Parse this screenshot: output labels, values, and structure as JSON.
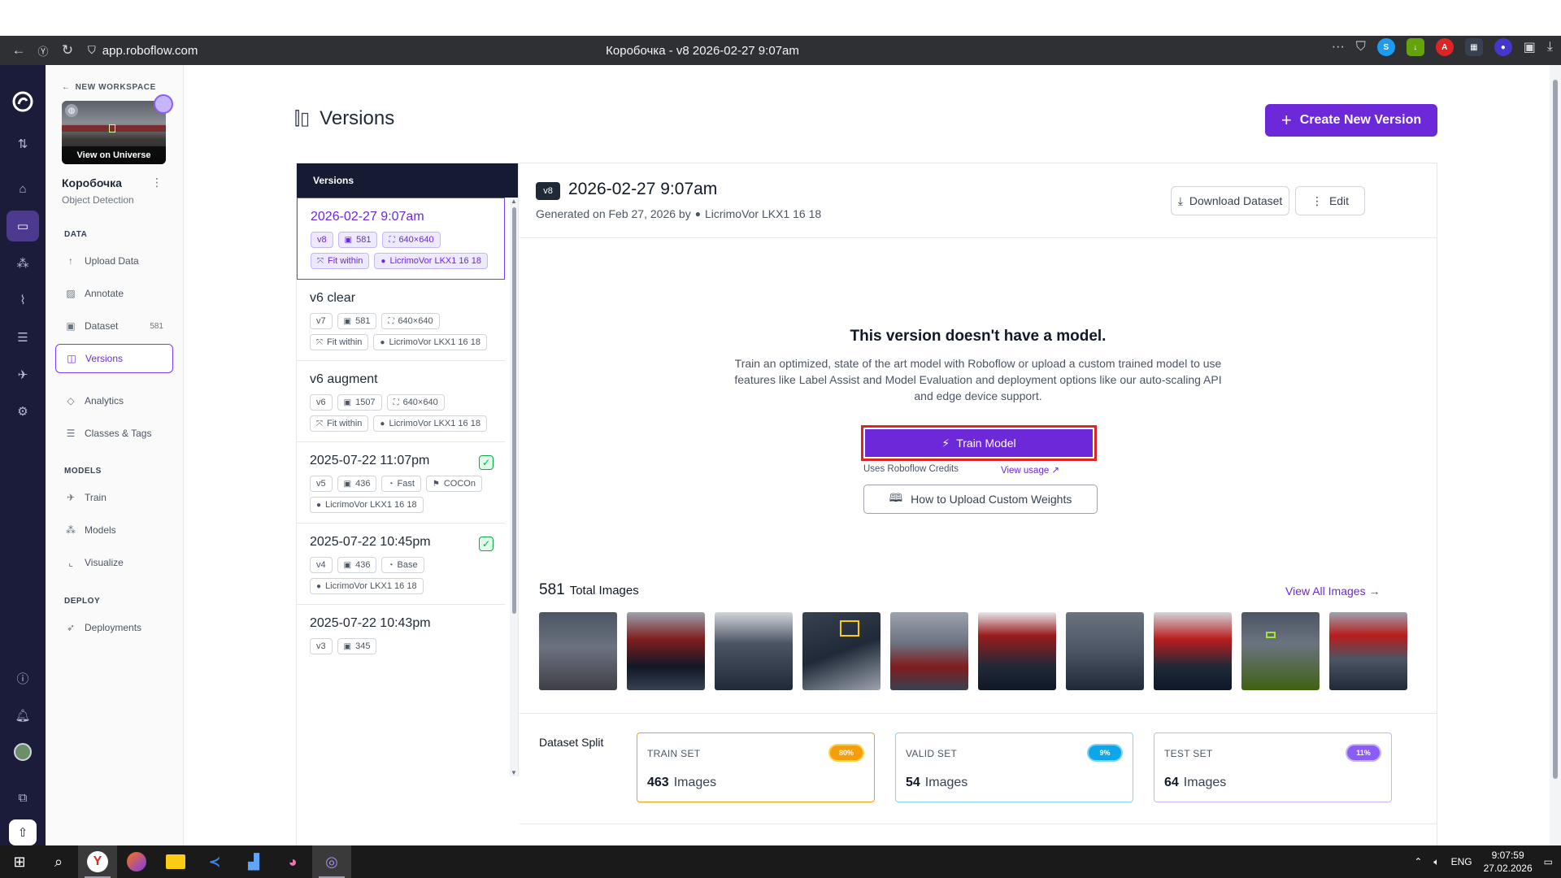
{
  "browser": {
    "url": "app.roboflow.com",
    "tab_title": "Коробочка - v8 2026-02-27 9:07am"
  },
  "sidebar": {
    "back_label": "NEW WORKSPACE",
    "thumb_label": "View on Universe",
    "project_name": "Коробочка",
    "project_type": "Object Detection",
    "sections": {
      "data": "DATA",
      "models": "MODELS",
      "deploy": "DEPLOY"
    },
    "items": [
      {
        "label": "Upload Data"
      },
      {
        "label": "Annotate"
      },
      {
        "label": "Dataset",
        "count": "581"
      },
      {
        "label": "Versions"
      },
      {
        "label": "Analytics"
      },
      {
        "label": "Classes & Tags"
      },
      {
        "label": "Train"
      },
      {
        "label": "Models"
      },
      {
        "label": "Visualize"
      },
      {
        "label": "Deployments"
      }
    ]
  },
  "main": {
    "title": "Versions",
    "create_button": "Create New Version",
    "list_header": "Versions",
    "versions": [
      {
        "name": "2026-02-27 9:07am",
        "v": "v8",
        "images": "581",
        "size": "640×640",
        "resize": "Fit within",
        "user": "LicrimoVor LKX1 16 18"
      },
      {
        "name": "v6 clear",
        "v": "v7",
        "images": "581",
        "size": "640×640",
        "resize": "Fit within",
        "user": "LicrimoVor LKX1 16 18"
      },
      {
        "name": "v6 augment",
        "v": "v6",
        "images": "1507",
        "size": "640×640",
        "resize": "Fit within",
        "user": "LicrimoVor LKX1 16 18"
      },
      {
        "name": "2025-07-22 11:07pm",
        "v": "v5",
        "images": "436",
        "train": "Fast",
        "format": "COCOn",
        "user": "LicrimoVor LKX1 16 18"
      },
      {
        "name": "2025-07-22 10:45pm",
        "v": "v4",
        "images": "436",
        "train": "Base",
        "user": "LicrimoVor LKX1 16 18"
      },
      {
        "name": "2025-07-22 10:43pm",
        "v": "v3",
        "images": "345"
      }
    ],
    "detail": {
      "badge": "v8",
      "title": "2026-02-27 9:07am",
      "generated": "Generated on Feb 27, 2026 by",
      "user": "LicrimoVor LKX1 16 18",
      "download_button": "Download Dataset",
      "edit_button": "Edit",
      "no_model_title": "This version doesn't have a model.",
      "no_model_desc": "Train an optimized, state of the art model with Roboflow or upload a custom trained model to use features like Label Assist and Model Evaluation and deployment options like our auto-scaling API and edge device support.",
      "train_button": "Train Model",
      "credits_text": "Uses Roboflow Credits",
      "view_usage": "View usage ↗",
      "upload_weights_button": "How to Upload Custom Weights",
      "total_images_num": "581",
      "total_images_label": "Total Images",
      "view_all": "View All Images →",
      "split_label": "Dataset Split",
      "splits": [
        {
          "name": "TRAIN SET",
          "pct": "80%",
          "count": "463",
          "unit": "Images",
          "color": "#f59e0b"
        },
        {
          "name": "VALID SET",
          "pct": "9%",
          "count": "54",
          "unit": "Images",
          "color": "#0ea5e9"
        },
        {
          "name": "TEST SET",
          "pct": "11%",
          "count": "64",
          "unit": "Images",
          "color": "#8b5cf6"
        }
      ]
    }
  },
  "taskbar": {
    "lang": "ENG",
    "time": "9:07:59",
    "date": "27.02.2026"
  },
  "colors": {
    "accent": "#6d28d9",
    "rail": "#1b1b3a",
    "highlight": "#dc2626"
  }
}
